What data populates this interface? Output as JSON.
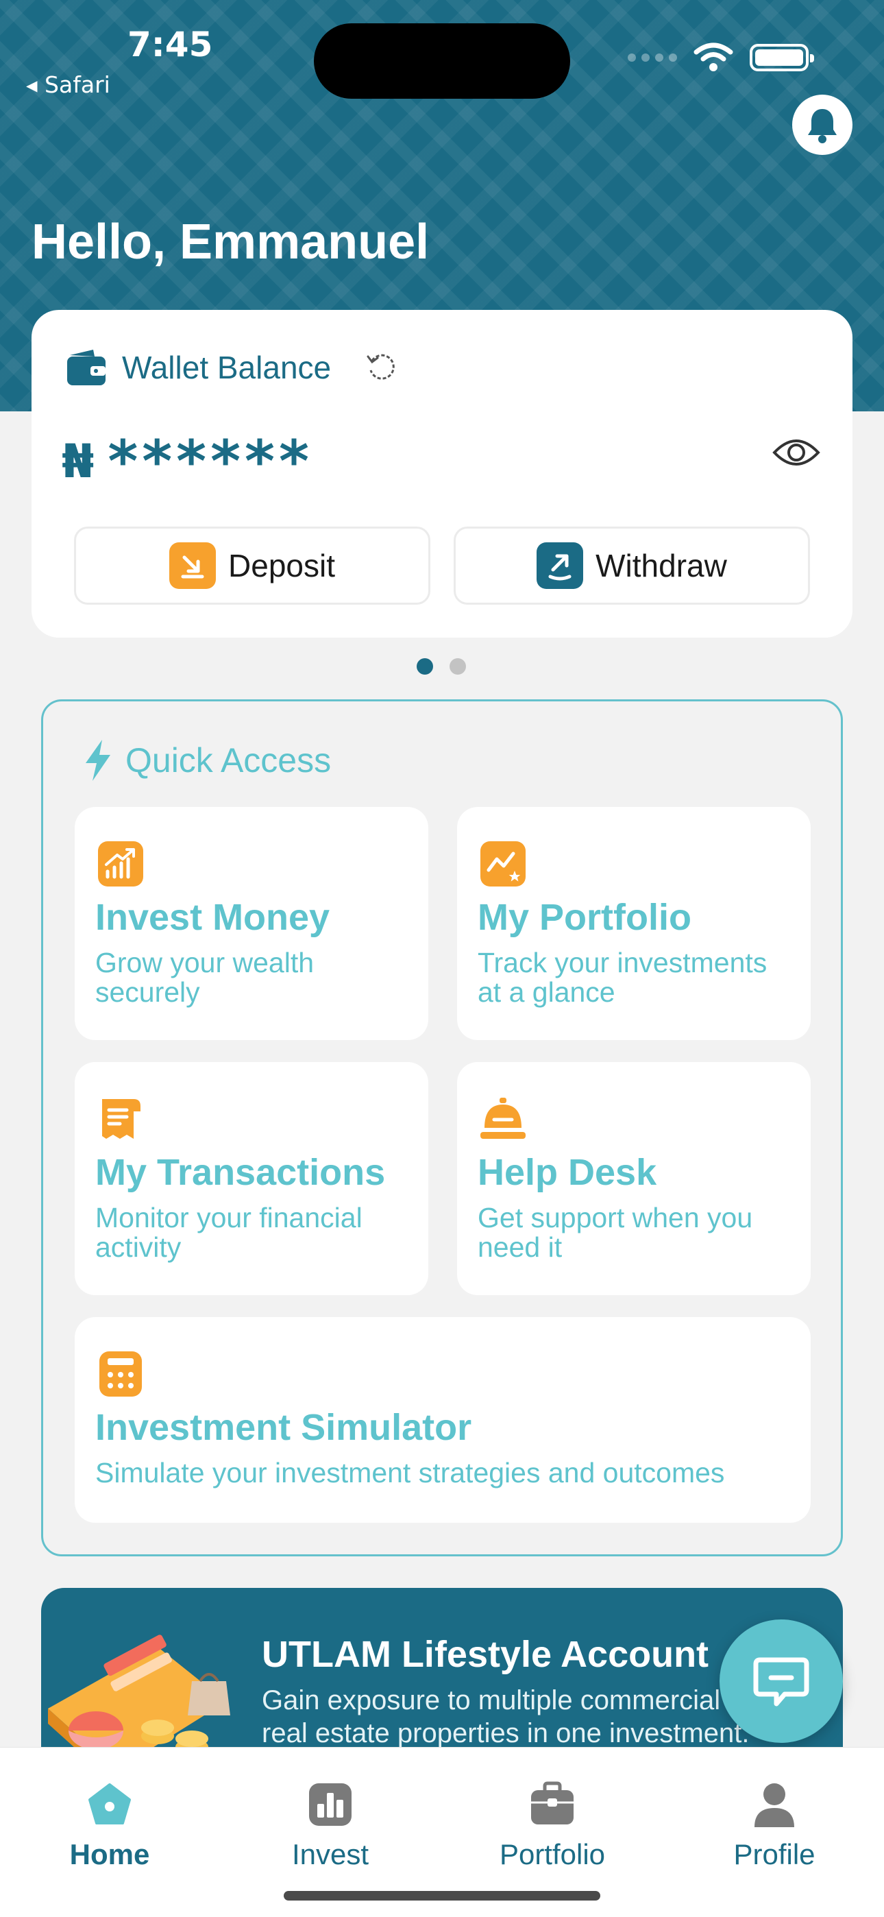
{
  "status_bar": {
    "time": "7:45",
    "back_app": "◂ Safari"
  },
  "header": {
    "greeting": "Hello, Emmanuel"
  },
  "wallet": {
    "title": "Wallet Balance",
    "currency_symbol": "₦",
    "balance_masked": "******",
    "deposit_label": "Deposit",
    "withdraw_label": "Withdraw"
  },
  "pager": {
    "pages": 2,
    "active": 1
  },
  "quick_access": {
    "title": "Quick Access",
    "items": [
      {
        "title": "Invest Money",
        "desc": "Grow your wealth securely",
        "icon": "invest-chart-icon"
      },
      {
        "title": "My Portfolio",
        "desc": "Track your investments at a glance",
        "icon": "portfolio-icon"
      },
      {
        "title": "My Transactions",
        "desc": "Monitor your financial activity",
        "icon": "receipt-icon"
      },
      {
        "title": "Help Desk",
        "desc": "Get support when you need it",
        "icon": "help-desk-bell-icon"
      },
      {
        "title": "Investment Simulator",
        "desc": "Simulate your investment strategies and outcomes",
        "icon": "calculator-icon"
      }
    ]
  },
  "promo": {
    "title": "UTLAM Lifestyle Account",
    "desc": "Gain exposure to multiple commercial real estate properties in one investment."
  },
  "tabbar": {
    "items": [
      {
        "label": "Home",
        "active": true,
        "icon": "home-icon"
      },
      {
        "label": "Invest",
        "active": false,
        "icon": "invest-icon"
      },
      {
        "label": "Portfolio",
        "active": false,
        "icon": "briefcase-icon"
      },
      {
        "label": "Profile",
        "active": false,
        "icon": "profile-icon"
      }
    ]
  },
  "colors": {
    "primary": "#1b6b85",
    "accent": "#5ec3cd",
    "orange": "#f7a12d"
  }
}
